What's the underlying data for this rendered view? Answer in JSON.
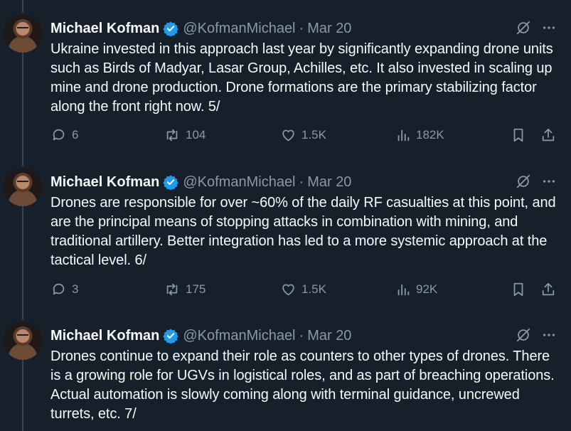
{
  "tweets": [
    {
      "name": "Michael Kofman",
      "handle": "@KofmanMichael",
      "separator": "·",
      "date": "Mar 20",
      "text": "Ukraine invested in this approach last year by significantly expanding drone units such as Birds of Madyar, Lasar Group, Achilles, etc. It also invested in scaling up mine and drone production. Drone formations are the primary stabilizing factor along the front right now. 5/",
      "replies": "6",
      "reposts": "104",
      "likes": "1.5K",
      "views": "182K"
    },
    {
      "name": "Michael Kofman",
      "handle": "@KofmanMichael",
      "separator": "·",
      "date": "Mar 20",
      "text": "Drones are responsible for over ~60% of the daily RF casualties at this point, and are the principal means of stopping attacks in combination with mining, and traditional artillery. Better integration has led to a more systemic approach at the tactical level. 6/",
      "replies": "3",
      "reposts": "175",
      "likes": "1.5K",
      "views": "92K"
    },
    {
      "name": "Michael Kofman",
      "handle": "@KofmanMichael",
      "separator": "·",
      "date": "Mar 20",
      "text": "Drones continue to expand their role as counters to other types of drones. There is a growing role for UGVs in logistical roles, and as part of breaching operations. Actual automation is slowly coming along with terminal guidance, uncrewed turrets, etc. 7/"
    }
  ],
  "icons": {
    "verified": "verified-badge-icon",
    "grok": "grok-icon",
    "more": "more-icon",
    "reply": "reply-icon",
    "repost": "repost-icon",
    "like": "like-icon",
    "views": "views-icon",
    "bookmark": "bookmark-icon",
    "share": "share-icon"
  },
  "colors": {
    "background": "#15202b",
    "text": "#f7f9f9",
    "secondary_text": "#8b98a5",
    "verified_blue": "#1d9bf0",
    "thread_line": "#38444d"
  }
}
